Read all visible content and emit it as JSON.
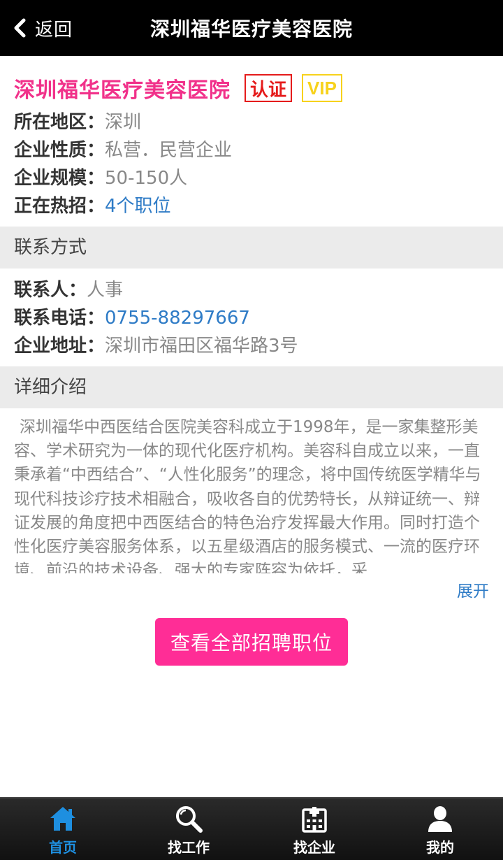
{
  "topbar": {
    "back_label": "返回",
    "title": "深圳福华医疗美容医院"
  },
  "company": {
    "name": "深圳福华医疗美容医院",
    "badge_cert": "认证",
    "badge_vip": "VIP",
    "fields": [
      {
        "key": "所在地区：",
        "value": "深圳"
      },
      {
        "key": "企业性质：",
        "value": "私营．民营企业"
      },
      {
        "key": "企业规模：",
        "value": "50-150人"
      },
      {
        "key": "正在热招：",
        "value": "4个职位"
      }
    ]
  },
  "contact": {
    "section_title": "联系方式",
    "fields": [
      {
        "key": "联系人：",
        "value": "人事"
      },
      {
        "key": "联系电话：",
        "value": "0755-88297667"
      },
      {
        "key": "企业地址：",
        "value": "深圳市福田区福华路3号"
      }
    ]
  },
  "detail": {
    "section_title": "详细介绍",
    "text": "深圳福华中西医结合医院美容科成立于1998年，是一家集整形美容、学术研究为一体的现代化医疗机构。美容科自成立以来，一直秉承着“中西结合”、“人性化服务”的理念，将中国传统医学精华与现代科技诊疗技术相融合，吸收各自的优势特长，从辩证统一、辩证发展的角度把中西医结合的特色治疗发挥最大作用。同时打造个性化医疗美容服务体系，以五星级酒店的服务模式、一流的医疗环境、前沿的技术设备、强大的专家阵容为依托，采",
    "expand_label": "展开"
  },
  "cta_label": "查看全部招聘职位",
  "bottom_nav": [
    {
      "label": "首页",
      "icon": "home-icon",
      "active": true
    },
    {
      "label": "找工作",
      "icon": "search-icon",
      "active": false
    },
    {
      "label": "找企业",
      "icon": "hospital-icon",
      "active": false
    },
    {
      "label": "我的",
      "icon": "user-icon",
      "active": false
    }
  ],
  "colors": {
    "brand_pink": "#f1318a",
    "cta_pink": "#ff2d96",
    "link_blue": "#2e7bc6",
    "cert_red": "#e51b1b",
    "vip_yellow": "#f7d21c",
    "nav_active": "#1e8fe0"
  }
}
